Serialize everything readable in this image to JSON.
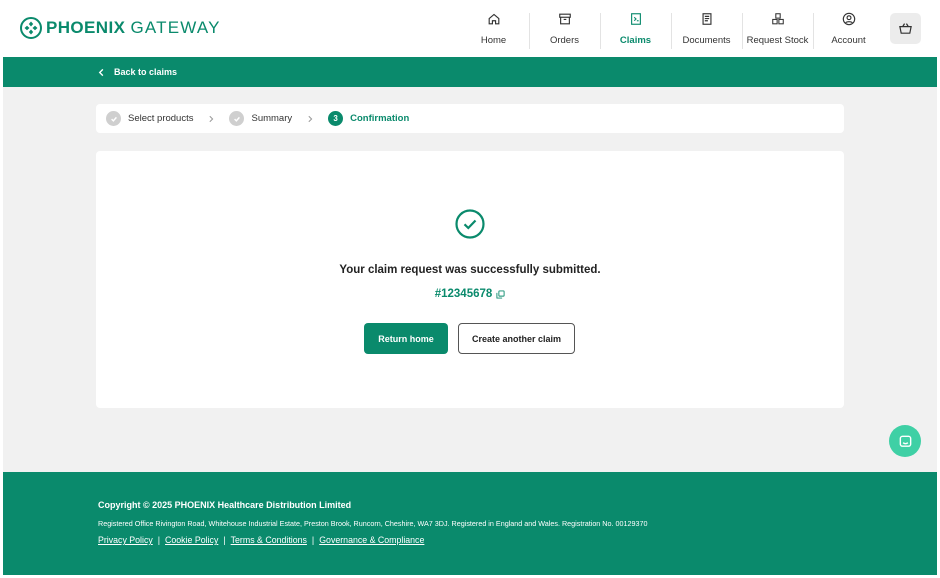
{
  "header": {
    "logo": {
      "brand_bold": "PHOENIX",
      "brand_light": "GATEWAY",
      "icon": "phoenix-logo-icon"
    },
    "nav": [
      {
        "label": "Home",
        "icon": "home-icon"
      },
      {
        "label": "Orders",
        "icon": "archive-box-icon"
      },
      {
        "label": "Claims",
        "icon": "claims-document-icon",
        "active": true
      },
      {
        "label": "Documents",
        "icon": "documents-icon"
      },
      {
        "label": "Request Stock",
        "icon": "stacked-boxes-icon"
      },
      {
        "label": "Account",
        "icon": "user-circle-icon"
      }
    ],
    "basket_icon": "basket-icon"
  },
  "subbar": {
    "back_label": "Back to claims"
  },
  "stepper": {
    "steps": [
      {
        "label": "Select products",
        "state": "complete"
      },
      {
        "label": "Summary",
        "state": "complete"
      },
      {
        "label": "Confirmation",
        "state": "current",
        "number": "3"
      }
    ]
  },
  "confirmation": {
    "message": "Your claim request was successfully submitted.",
    "reference": "#12345678",
    "primary_button": "Return home",
    "secondary_button": "Create another claim"
  },
  "footer": {
    "copyright": "Copyright © 2025 PHOENIX Healthcare Distribution Limited",
    "registered": "Registered Office Rivington Road, Whitehouse Industrial Estate, Preston Brook, Runcorn, Cheshire, WA7 3DJ. Registered in England and Wales. Registration No. 00129370",
    "links": [
      "Privacy Policy",
      "Cookie Policy",
      "Terms & Conditions",
      "Governance & Compliance"
    ],
    "separator": "|"
  },
  "colors": {
    "brand_green": "#0a8a6c",
    "chat_green": "#3fd0a5",
    "page_bg": "#f1f1f1"
  }
}
